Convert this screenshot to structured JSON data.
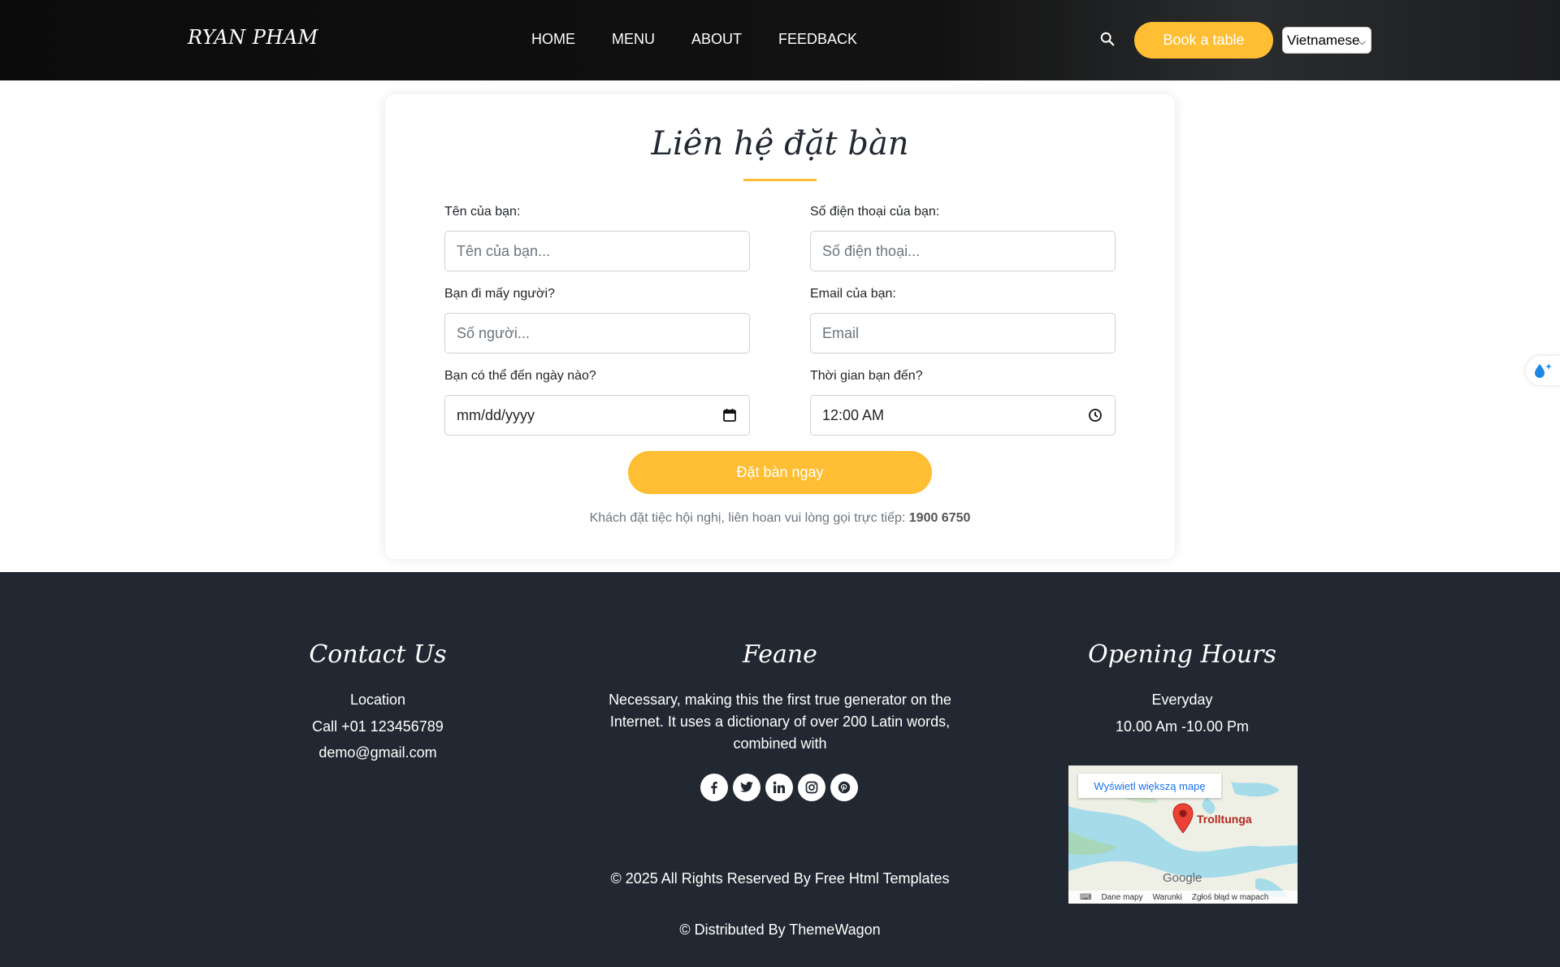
{
  "header": {
    "logo": "RYAN PHAM",
    "nav": [
      "HOME",
      "MENU",
      "ABOUT",
      "FEEDBACK"
    ],
    "book_label": "Book a table",
    "language": "Vietnamese",
    "colors": {
      "background": "#0b0b0b",
      "accent": "#ffbe33"
    }
  },
  "booking": {
    "title": "Liên hệ đặt bàn",
    "name": {
      "label": "Tên của bạn:",
      "placeholder": "Tên của bạn..."
    },
    "phone": {
      "label": "Số điện thoại của bạn:",
      "placeholder": "Số điện thoại..."
    },
    "guests": {
      "label": "Bạn đi mấy người?",
      "placeholder": "Số người..."
    },
    "email": {
      "label": "Email của bạn:",
      "placeholder": "Email"
    },
    "date": {
      "label": "Bạn có thể đến ngày nào?",
      "value": "mm/dd/yyyy"
    },
    "time": {
      "label": "Thời gian bạn đến?",
      "value": "12:00 AM"
    },
    "submit_label": "Đặt bàn ngay",
    "note_text": "Khách đặt tiệc hội nghị, liên hoan vui lòng gọi trực tiếp:",
    "note_phone": "1900 6750"
  },
  "footer": {
    "contact": {
      "title": "Contact Us",
      "location": "Location",
      "phone": "Call +01 123456789",
      "email": "demo@gmail.com"
    },
    "brand": {
      "title": "Feane",
      "description": "Necessary, making this the first true generator on the Internet. It uses a dictionary of over 200 Latin words, combined with",
      "socials": [
        "facebook-icon",
        "twitter-icon",
        "linkedin-icon",
        "instagram-icon",
        "pinterest-icon"
      ]
    },
    "hours": {
      "title": "Opening Hours",
      "days": "Everyday",
      "time": "10.00 Am -10.00 Pm"
    },
    "map": {
      "link": "Wyświetl większą mapę",
      "place": "Trolltunga",
      "brand": "Google",
      "bottom": [
        "Dane mapy",
        "Warunki",
        "Zgłoś błąd w mapach"
      ]
    },
    "copyright": "© 2025 All Rights Reserved By Free Html Templates",
    "distributed": "© Distributed By ThemeWagon",
    "colors": {
      "background": "#222831"
    }
  }
}
